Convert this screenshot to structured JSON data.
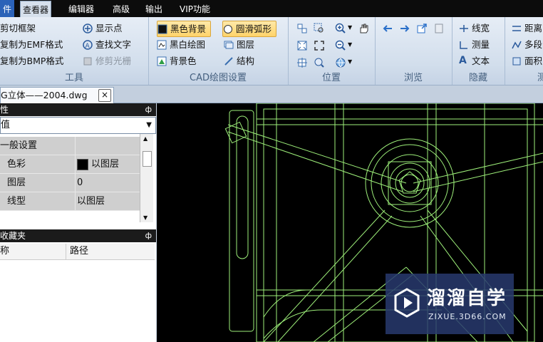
{
  "menu": {
    "items": [
      "件",
      "查看器",
      "编辑器",
      "高级",
      "输出",
      "VIP功能"
    ]
  },
  "ribbon": {
    "tools": {
      "label": "工具",
      "cut_frame": "剪切框架",
      "copy_emf": "复制为EMF格式",
      "copy_bmp": "复制为BMP格式",
      "show_point": "显示点",
      "find_text": "查找文字",
      "trim_raster": "修剪光栅"
    },
    "cad": {
      "label": "CAD绘图设置",
      "black_bg": "黑色背景",
      "smooth_arc": "圆滑弧形",
      "bw_draw": "黑白绘图",
      "layer": "图层",
      "bg_color": "背景色",
      "structure": "结构"
    },
    "position": {
      "label": "位置"
    },
    "browse": {
      "label": "浏览"
    },
    "hide": {
      "label": "隐藏",
      "line_width": "线宽",
      "measure": "测量",
      "text": "文本"
    },
    "measure": {
      "distance": "距离",
      "polyline": "多段",
      "area": "面积",
      "label": "测"
    }
  },
  "tabs": {
    "doc_title": "G立体——2004.dwg",
    "close": "×"
  },
  "properties": {
    "header": "性",
    "pin": "ф",
    "combo_value": "值",
    "rows": [
      {
        "key": "一般设置",
        "value": ""
      },
      {
        "key": "色彩",
        "value": "以图层"
      },
      {
        "key": "图层",
        "value": "0"
      },
      {
        "key": "线型",
        "value": "以图层"
      }
    ]
  },
  "favorites": {
    "header": "收藏夹",
    "pin": "ф",
    "col_name": "称",
    "col_path": "路径"
  },
  "watermark": {
    "brand": "溜溜自学",
    "url": "ZIXUE.3D66.COM"
  },
  "colors": {
    "cad_line": "#9ef07a",
    "canvas_bg": "#000000",
    "menubar": "#0c0c0c"
  }
}
